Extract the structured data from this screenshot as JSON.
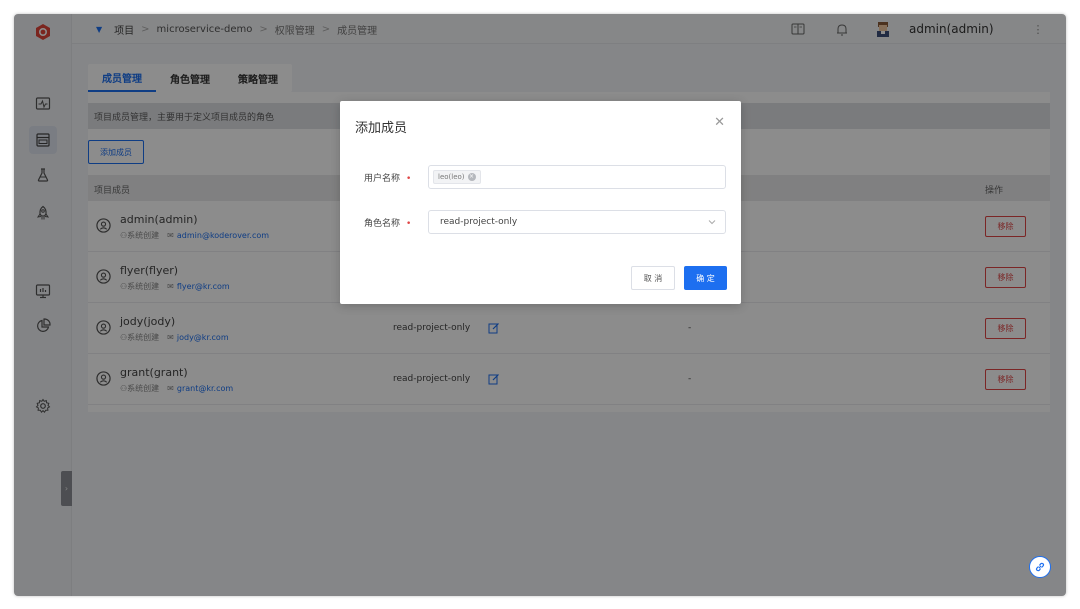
{
  "colors": {
    "accent": "#1d6ff0",
    "danger": "#e04545",
    "logo": "#e0443a"
  },
  "header": {
    "breadcrumbs": [
      "项目",
      "microservice-demo",
      "权限管理",
      "成员管理"
    ],
    "user": "admin(admin)"
  },
  "tabs": [
    "成员管理",
    "角色管理",
    "策略管理"
  ],
  "description": "项目成员管理，主要用于定义项目成员的角色",
  "add_button": "添加成员",
  "table": {
    "headers": {
      "member": "项目成员",
      "action": "操作"
    },
    "rows": [
      {
        "name": "admin(admin)",
        "source": "系统创建",
        "email": "admin@koderover.com",
        "role": "",
        "extra": "",
        "remove": "移除"
      },
      {
        "name": "flyer(flyer)",
        "source": "系统创建",
        "email": "flyer@kr.com",
        "role": "",
        "extra": "",
        "remove": "移除"
      },
      {
        "name": "jody(jody)",
        "source": "系统创建",
        "email": "jody@kr.com",
        "role": "read-project-only",
        "extra": "-",
        "remove": "移除"
      },
      {
        "name": "grant(grant)",
        "source": "系统创建",
        "email": "grant@kr.com",
        "role": "read-project-only",
        "extra": "-",
        "remove": "移除"
      }
    ]
  },
  "modal": {
    "title": "添加成员",
    "user_label": "用户名称",
    "user_tag": "leo(leo)",
    "role_label": "角色名称",
    "role_value": "read-project-only",
    "cancel": "取 消",
    "confirm": "确 定"
  },
  "icons": {
    "sidebar": [
      "logo-icon",
      "monitor-icon",
      "project-icon",
      "flask-icon",
      "rocket-icon",
      "dashboard-icon",
      "chart-icon",
      "gear-icon"
    ],
    "header": [
      "doc-icon",
      "bell-icon",
      "avatar",
      "more-icon"
    ]
  }
}
